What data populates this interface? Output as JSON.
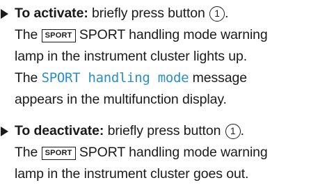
{
  "steps": [
    {
      "marker_icon": "triangle-right",
      "lead": "To activate:",
      "line1_text": " briefly press button ",
      "button_number": "1",
      "line1_end": ".",
      "line2_pre": "The ",
      "lamp_label": "SPORT",
      "line2_post": " SPORT handling mode warning",
      "line3": "lamp in the instrument cluster lights up.",
      "line4_pre": "The ",
      "display_message": "SPORT handling mode",
      "line4_post": " message",
      "line5": "appears in the multifunction display."
    },
    {
      "marker_icon": "triangle-right",
      "lead": "To deactivate:",
      "line1_text": " briefly press button ",
      "button_number": "1",
      "line1_end": ".",
      "line2_pre": "The ",
      "lamp_label": "SPORT",
      "line2_post": " SPORT handling mode warning",
      "line3": "lamp in the instrument cluster goes out."
    }
  ],
  "colors": {
    "text": "#1a1a1a",
    "display_message": "#2a8fc4",
    "background": "#ffffff"
  }
}
